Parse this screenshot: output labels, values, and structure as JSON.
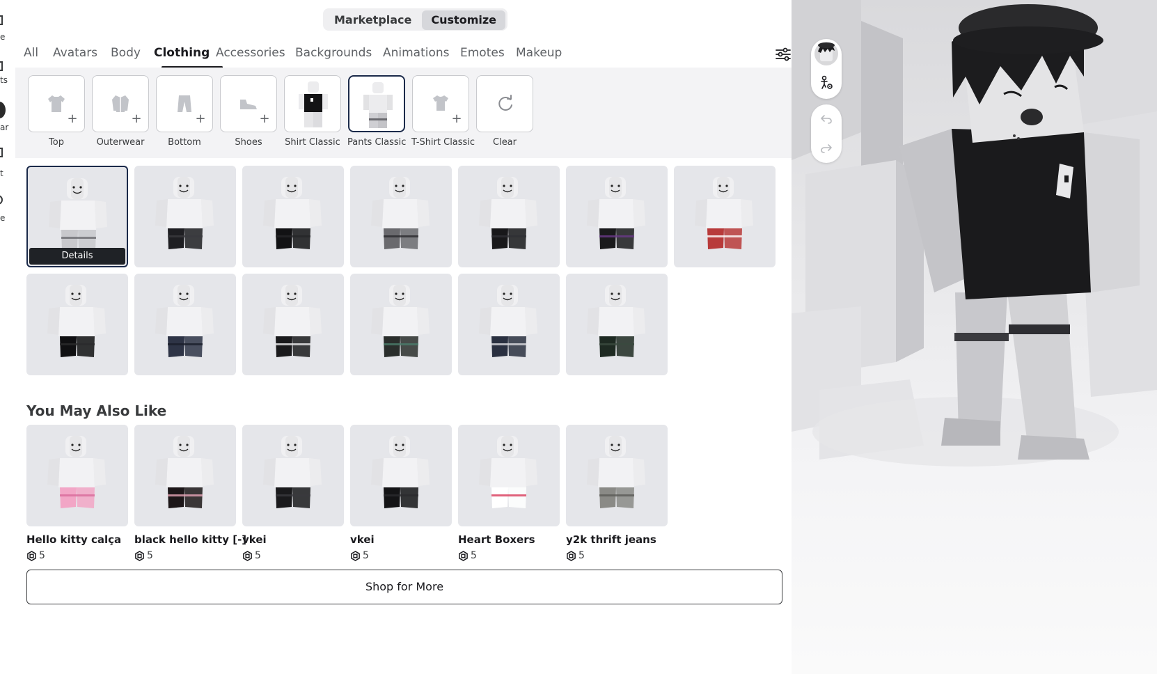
{
  "left_nav": {
    "fragments": [
      "e",
      "ts",
      "ar",
      "t",
      "e"
    ]
  },
  "toggle": {
    "marketplace": "Marketplace",
    "customize": "Customize"
  },
  "tabs": [
    {
      "label": "All"
    },
    {
      "label": "Avatars"
    },
    {
      "label": "Body"
    },
    {
      "label": "Clothing"
    },
    {
      "label": "Accessories"
    },
    {
      "label": "Backgrounds"
    },
    {
      "label": "Animations"
    },
    {
      "label": "Emotes"
    },
    {
      "label": "Makeup"
    }
  ],
  "active_tab": "Clothing",
  "subcategories": [
    {
      "label": "Top",
      "icon": "shirt-add-icon"
    },
    {
      "label": "Outerwear",
      "icon": "jacket-add-icon"
    },
    {
      "label": "Bottom",
      "icon": "pants-add-icon"
    },
    {
      "label": "Shoes",
      "icon": "shoe-add-icon"
    },
    {
      "label": "Shirt Classic",
      "icon": "avatar-thumbnail"
    },
    {
      "label": "Pants Classic",
      "icon": "avatar-thumbnail"
    },
    {
      "label": "T-Shirt Classic",
      "icon": "tshirt-add-icon"
    },
    {
      "label": "Clear",
      "icon": "refresh-icon"
    }
  ],
  "selected_subcategory": "Pants Classic",
  "grid": {
    "details_label": "Details",
    "items": [
      {
        "pants_color": "#c8c8cc",
        "accent": "#6b6b70"
      },
      {
        "pants_color": "#1e1e22",
        "accent": "#3a3a3e"
      },
      {
        "pants_color": "#121214",
        "accent": "#262628"
      },
      {
        "pants_color": "#6a6a6e",
        "accent": "#2a2a2e"
      },
      {
        "pants_color": "#18181a",
        "accent": "#303034"
      },
      {
        "pants_color": "#1a1a1c",
        "accent": "#6a3a8a"
      },
      {
        "pants_color": "#b83a3a",
        "accent": "#ffffff"
      },
      {
        "pants_color": "#101012",
        "accent": "#2a2a2c"
      },
      {
        "pants_color": "#2e3446",
        "accent": "#1a1e2a"
      },
      {
        "pants_color": "#1a1a1c",
        "accent": "#e8e8ea"
      },
      {
        "pants_color": "#2a2e2c",
        "accent": "#4a7a6a"
      },
      {
        "pants_color": "#2a3040",
        "accent": "#d8d8dc"
      },
      {
        "pants_color": "#1e2a22",
        "accent": "#3a4a3e"
      }
    ]
  },
  "recommendations": {
    "title": "You May Also Like",
    "items": [
      {
        "name": "Hello kitty calça",
        "price": "5",
        "pants_color": "#f2a6c6",
        "accent": "#d86a9a"
      },
      {
        "name": "black hello kitty [-]",
        "price": "5",
        "pants_color": "#1c1618",
        "accent": "#e8a6b8"
      },
      {
        "name": "vkei",
        "price": "5",
        "pants_color": "#1a1a1c",
        "accent": "#3a3a3e"
      },
      {
        "name": "vkei",
        "price": "5",
        "pants_color": "#141416",
        "accent": "#2a2a2e"
      },
      {
        "name": "Heart Boxers",
        "price": "5",
        "pants_color": "#ffffff",
        "accent": "#d83a5a"
      },
      {
        "name": "y2k thrift jeans",
        "price": "5",
        "pants_color": "#8a8a86",
        "accent": "#5a5a56"
      }
    ],
    "currency_icon": "robux-icon"
  },
  "shop_more": "Shop for More",
  "colors": {
    "selected_border": "#1b2a4a",
    "tile_bg": "#e5e6ea",
    "text_primary": "#1b1b1f"
  }
}
